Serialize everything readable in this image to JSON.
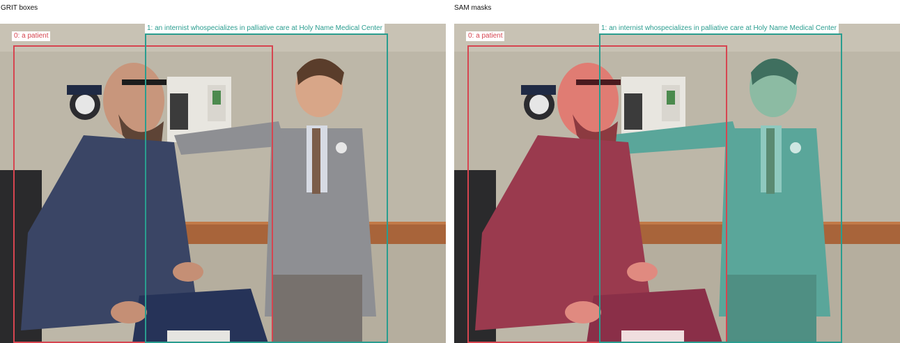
{
  "panels": {
    "left_title": "GRIT boxes",
    "right_title": "SAM masks"
  },
  "detections": [
    {
      "label": "0: a patient",
      "color": "#d64550"
    },
    {
      "label": "1: an internist whospecializes in palliative care at Holy Name Medical Center",
      "color": "#2a9d8f"
    }
  ],
  "icons": {
    "left_photo": "exam-room-photo",
    "right_photo": "exam-room-photo-with-masks"
  }
}
